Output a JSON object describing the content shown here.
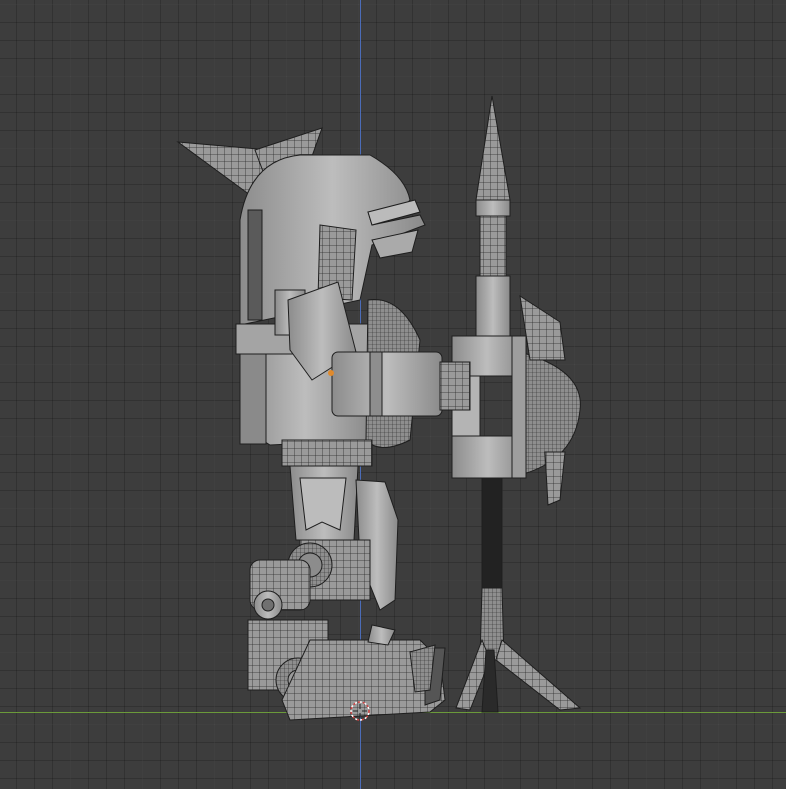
{
  "viewport": {
    "view": "side-orthographic",
    "colors": {
      "background": "#3d3d3d",
      "grid_minor": "#363636",
      "grid_major": "#474747",
      "axis_z": "#4b6cb8",
      "axis_y": "#6b9a3a",
      "mesh_fill": "#a9a9a9",
      "mesh_wire": "#1e1e1e",
      "selection": "#e08a2c",
      "cursor": "#d04040"
    },
    "icons": {
      "cursor": "3d-cursor-icon"
    }
  }
}
